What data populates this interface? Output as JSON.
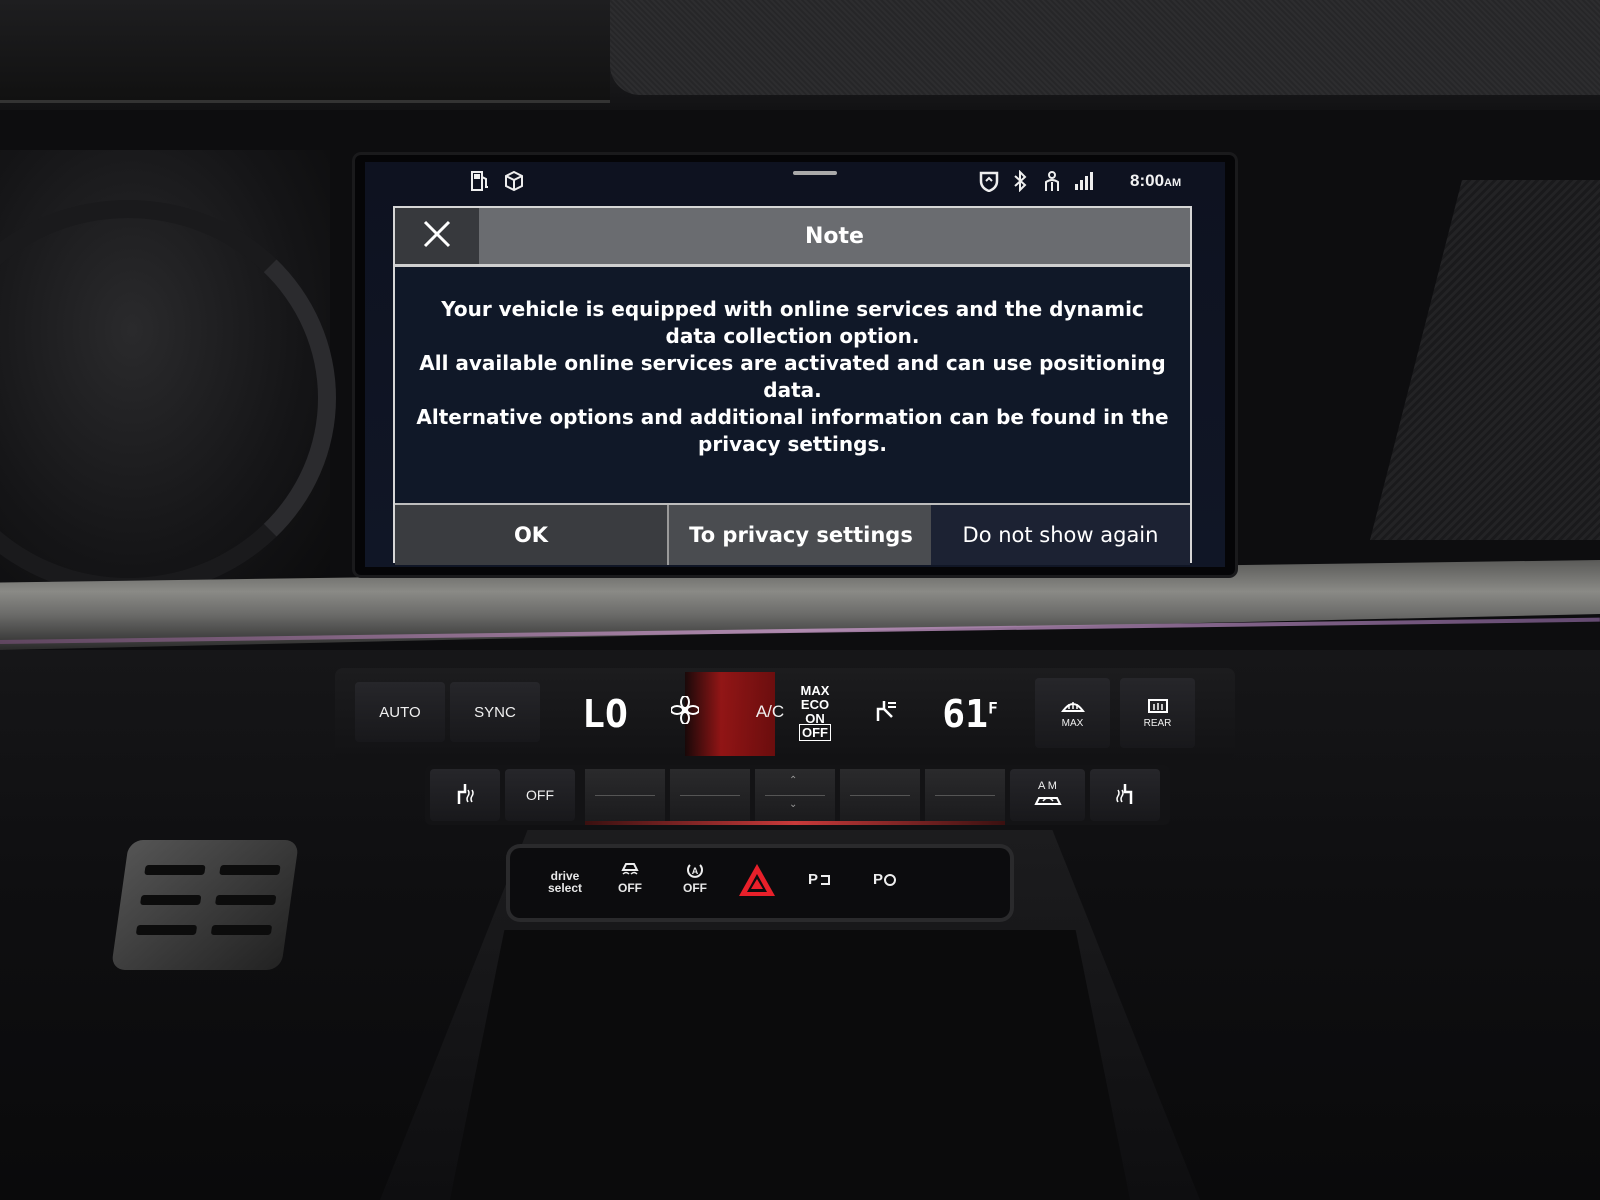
{
  "status_bar": {
    "time": "8:00",
    "time_suffix": "AM",
    "icons": [
      "fuel-pump-icon",
      "cube-icon",
      "navigation-shield-icon",
      "bluetooth-icon",
      "person-icon",
      "signal-icon"
    ]
  },
  "dialog": {
    "title": "Note",
    "close_icon": "close-icon",
    "message_lines": [
      "Your vehicle is equipped with online services and the dynamic data collection option.",
      "All available online services are activated and can use positioning data.",
      "Alternative options and additional information can be found in the privacy settings."
    ],
    "buttons": {
      "ok": "OK",
      "privacy": "To privacy settings",
      "no_show": "Do not show again"
    }
  },
  "climate": {
    "auto": "AUTO",
    "sync": "SYNC",
    "temp_left": "LO",
    "ac": "A/C",
    "eco_lines": [
      "MAX",
      "ECO",
      "ON"
    ],
    "eco_off": "OFF",
    "temp_right": "61",
    "temp_unit": "F",
    "max_label": "MAX",
    "rear_label": "REAR",
    "off_label": "OFF",
    "am_label": "A  M"
  },
  "drive_strip": {
    "drive_select": "drive select",
    "esc_off": "OFF",
    "start_stop_off": "OFF"
  },
  "colors": {
    "dialog_header": "#6a6c70",
    "dialog_bg": "#101828",
    "hazard": "#e8202a"
  }
}
